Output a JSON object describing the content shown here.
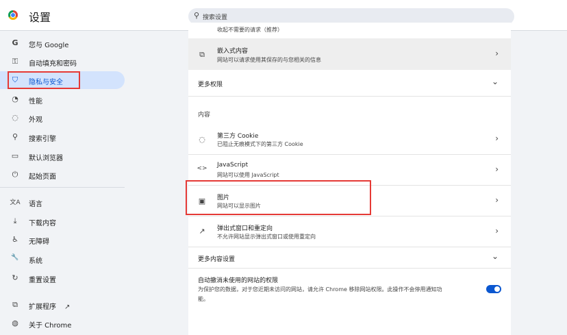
{
  "header": {
    "title": "设置",
    "search_placeholder": "搜索设置"
  },
  "sidebar": {
    "items": [
      {
        "icon": "G",
        "label": "您与 Google"
      },
      {
        "icon": "⚿",
        "label": "自动填充和密码"
      },
      {
        "icon": "⛉",
        "label": "隐私与安全"
      },
      {
        "icon": "◔",
        "label": "性能"
      },
      {
        "icon": "◌",
        "label": "外观"
      },
      {
        "icon": "⚲",
        "label": "搜索引擎"
      },
      {
        "icon": "▭",
        "label": "默认浏览器"
      },
      {
        "icon": "⏻",
        "label": "起始页面"
      },
      {
        "icon": "文A",
        "label": "语言"
      },
      {
        "icon": "⤓",
        "label": "下载内容"
      },
      {
        "icon": "♿",
        "label": "无障碍"
      },
      {
        "icon": "🔧",
        "label": "系统"
      },
      {
        "icon": "↻",
        "label": "重置设置"
      },
      {
        "icon": "⧉",
        "label": "扩展程序",
        "extra": "↗"
      },
      {
        "icon": "◍",
        "label": "关于 Chrome"
      }
    ]
  },
  "main": {
    "clipped_text": "收起不需要的请求（推荐）",
    "embedded": {
      "title": "嵌入式内容",
      "subtitle": "网站可以请求使用其保存的与您相关的信息"
    },
    "more_permissions": "更多权限",
    "content_label": "内容",
    "rows": [
      {
        "icon": "cookie",
        "title": "第三方 Cookie",
        "subtitle": "已阻止无痕模式下的第三方 Cookie"
      },
      {
        "icon": "code",
        "title": "JavaScript",
        "subtitle": "网站可以使用 JavaScript"
      },
      {
        "icon": "image",
        "title": "图片",
        "subtitle": "网站可以显示图片"
      },
      {
        "icon": "popup",
        "title": "弹出式窗口和重定向",
        "subtitle": "不允许网站显示弹出式窗口或使用重定向"
      }
    ],
    "more_content_settings": "更多内容设置",
    "auto_revoke": {
      "title": "自动撤消未使用的网站的权限",
      "desc_line1": "为保护您的数据，对于您近期未访问的网站，请允许 Chrome 移除网站权限。此操作不会停用通知功",
      "desc_line2": "能。",
      "enabled": true
    }
  },
  "colors": {
    "accent": "#0b57d0",
    "highlight_box": "#e53935",
    "active_bg": "#d3e3fd"
  }
}
